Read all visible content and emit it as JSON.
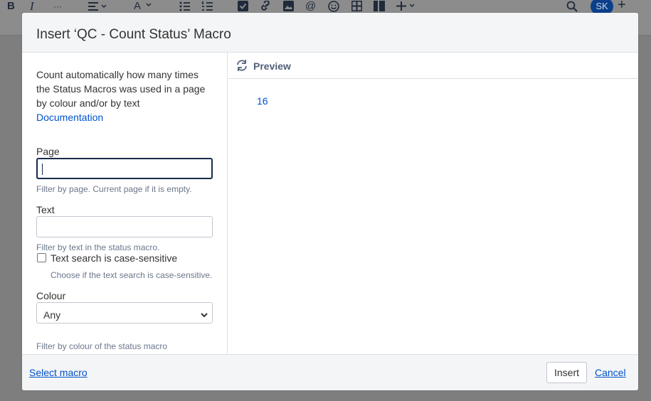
{
  "toolbar": {
    "bold_glyph": "B",
    "italic_glyph": "I",
    "more_glyph": "···",
    "avatar_initials": "SK",
    "plus_glyph": "+"
  },
  "dialog": {
    "title": "Insert ‘QC - Count Status’ Macro",
    "description": "Count automatically how many times the Status Macros was used in a page by colour and/or by text",
    "documentation_link": "Documentation",
    "page": {
      "label": "Page",
      "value": "",
      "help": "Filter by page. Current page if it is empty."
    },
    "text": {
      "label": "Text",
      "value": "",
      "help": "Filter by text in the status macro."
    },
    "case_sensitive": {
      "label": "Text search is case-sensitive",
      "checked": false,
      "help": "Choose if the text search is case-sensitive."
    },
    "colour": {
      "label": "Colour",
      "selected": "Any",
      "help": "Filter by colour of the status macro"
    },
    "preview": {
      "title": "Preview",
      "value": "16"
    },
    "footer": {
      "select_macro": "Select macro",
      "insert": "Insert",
      "cancel": "Cancel"
    }
  },
  "colors": {
    "link": "#0052cc",
    "header_bg": "#f4f5f7",
    "avatar_bg": "#0b3f8a"
  }
}
